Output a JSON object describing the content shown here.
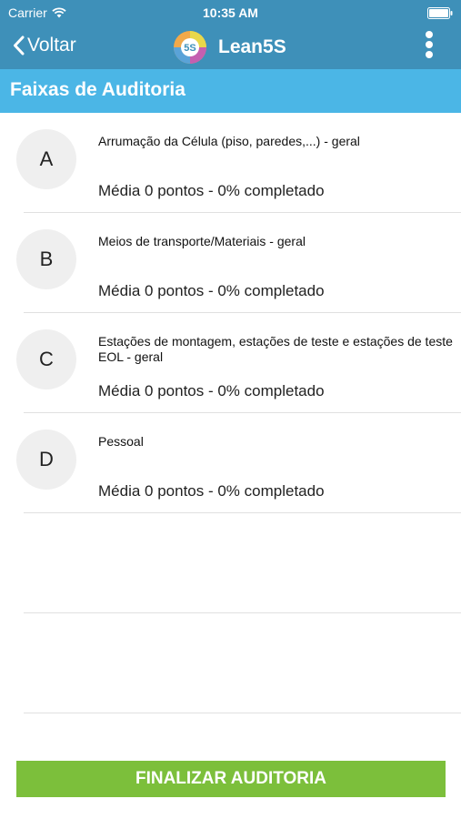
{
  "status_bar": {
    "carrier": "Carrier",
    "time": "10:35 AM"
  },
  "nav": {
    "back_label": "Voltar",
    "title": "Lean5S",
    "logo_text": "5S"
  },
  "section": {
    "title": "Faixas de Auditoria"
  },
  "items": [
    {
      "letter": "A",
      "title": "Arrumação da Célula (piso, paredes,...) - geral",
      "subtitle": "Média 0 pontos - 0% completado"
    },
    {
      "letter": "B",
      "title": "Meios de transporte/Materiais - geral",
      "subtitle": "Média 0 pontos - 0% completado"
    },
    {
      "letter": "C",
      "title": "Estações de montagem, estações de teste e estações de teste EOL - geral",
      "subtitle": "Média 0 pontos - 0% completado"
    },
    {
      "letter": "D",
      "title": "Pessoal",
      "subtitle": "Média 0 pontos - 0% completado"
    }
  ],
  "footer": {
    "finish_label": "FINALIZAR AUDITORIA"
  },
  "colors": {
    "nav_bar": "#3e90b9",
    "section_header": "#4bb6e6",
    "finish_button": "#7cbf3b"
  }
}
